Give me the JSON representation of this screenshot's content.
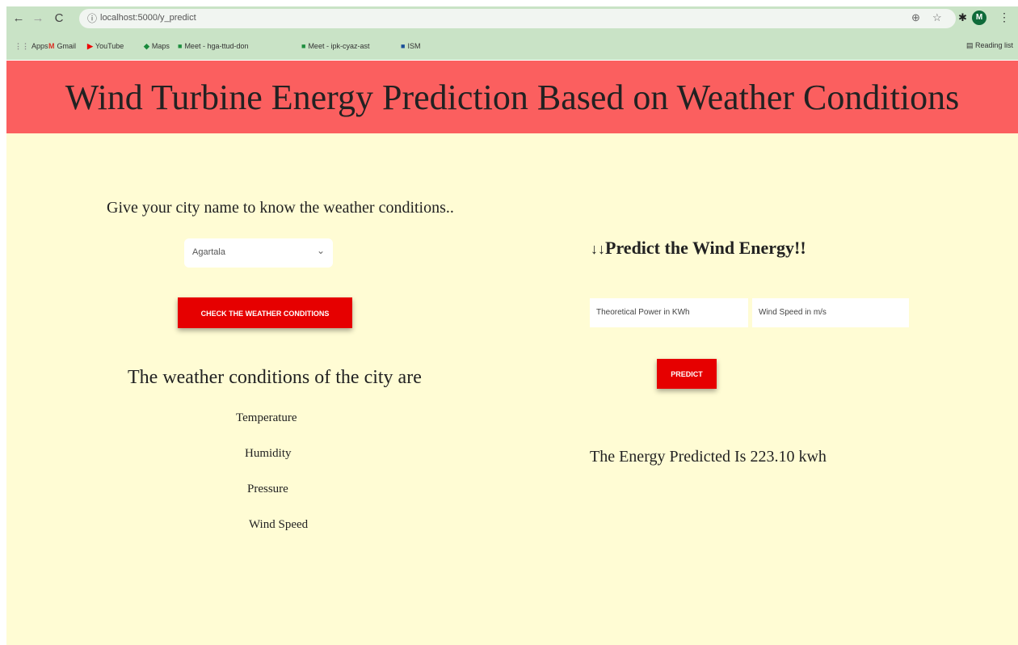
{
  "browser": {
    "url": "localhost:5000/y_predict",
    "avatar_letter": "M",
    "bookmarks": [
      {
        "icon": "⋮⋮",
        "label": "Apps"
      },
      {
        "icon": "M",
        "label": "Gmail"
      },
      {
        "icon": "▶",
        "label": "YouTube"
      },
      {
        "icon": "◆",
        "label": "Maps"
      },
      {
        "icon": "■",
        "label": "Meet - hga-ttud-don"
      },
      {
        "icon": "■",
        "label": "Meet - ipk-cyaz-ast"
      },
      {
        "icon": "■",
        "label": "ISM"
      }
    ],
    "reading_list": "Reading list",
    "colors": {
      "chrome": "#c9e3c6",
      "omnibox": "#f1f5f1"
    }
  },
  "header": {
    "title": "Wind Turbine Energy Prediction Based on Weather Conditions",
    "background": "#fb5f5f"
  },
  "weather": {
    "prompt": "Give your city name to know the weather conditions..",
    "selected_city": "Agartala",
    "check_button": "CHECK THE WEATHER CONDITIONS",
    "section_title": "The weather conditions of the city are",
    "items": [
      "Temperature",
      "Humidity",
      "Pressure",
      "Wind Speed"
    ]
  },
  "prediction": {
    "arrows": "↓↓",
    "title": "Predict the Wind Energy!!",
    "power_placeholder": "Theoretical Power in KWh",
    "speed_placeholder": "Wind Speed in m/s",
    "predict_button": "PREDICT",
    "result": "The Energy Predicted Is 223.10 kwh"
  },
  "colors": {
    "page_bg": "#fffcd4",
    "button": "#e60000"
  }
}
